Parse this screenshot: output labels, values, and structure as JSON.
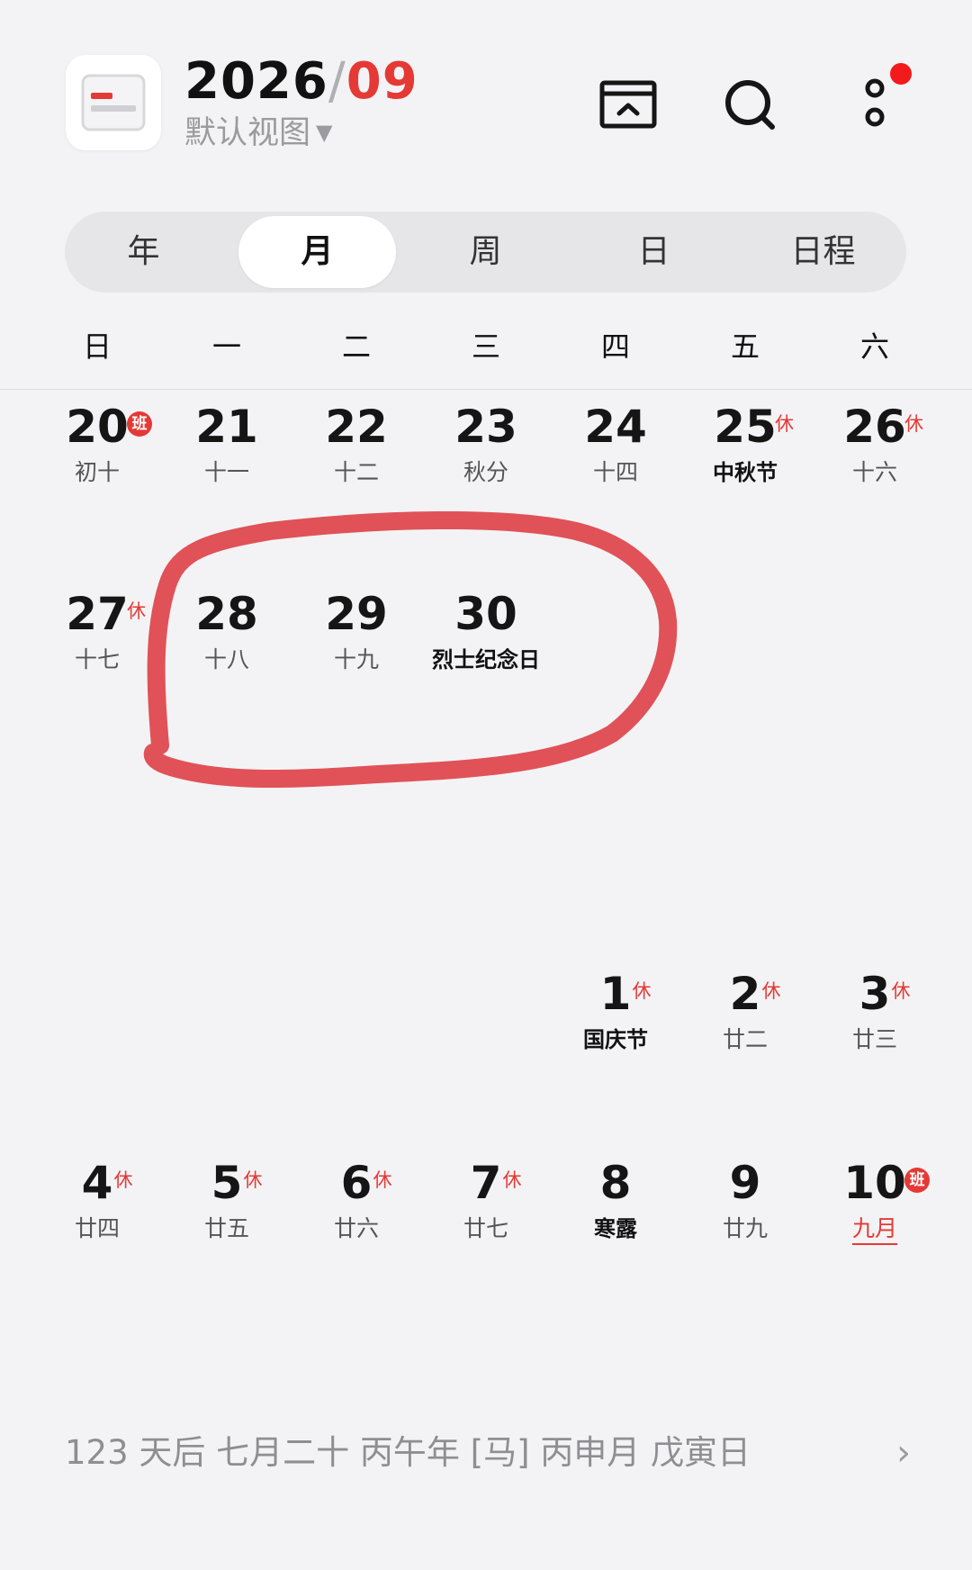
{
  "header": {
    "year": "2026",
    "slash": "/",
    "month": "09",
    "view_label": "默认视图",
    "view_caret": "▼",
    "icons": [
      "calendar-app-icon",
      "inbox-icon",
      "search-icon",
      "more-icon"
    ],
    "accent_color": "#e53935"
  },
  "tabs": [
    {
      "label": "年",
      "active": false
    },
    {
      "label": "月",
      "active": true
    },
    {
      "label": "周",
      "active": false
    },
    {
      "label": "日",
      "active": false
    },
    {
      "label": "日程",
      "active": false
    }
  ],
  "weekdays": [
    "日",
    "一",
    "二",
    "三",
    "四",
    "五",
    "六"
  ],
  "weeks": [
    [
      {
        "day": "20",
        "sub": "初十",
        "badge": "班"
      },
      {
        "day": "21",
        "sub": "十一"
      },
      {
        "day": "22",
        "sub": "十二"
      },
      {
        "day": "23",
        "sub": "秋分"
      },
      {
        "day": "24",
        "sub": "十四"
      },
      {
        "day": "25",
        "sub": "中秋节",
        "badge": "休",
        "holiday": true
      },
      {
        "day": "26",
        "sub": "十六",
        "badge": "休"
      }
    ],
    [
      {
        "day": "27",
        "sub": "十七",
        "badge": "休"
      },
      {
        "day": "28",
        "sub": "十八"
      },
      {
        "day": "29",
        "sub": "十九"
      },
      {
        "day": "30",
        "sub": "烈士纪念日",
        "holiday": true
      }
    ],
    [],
    [
      null,
      null,
      null,
      null,
      {
        "day": "1",
        "sub": "国庆节",
        "badge": "休",
        "holiday": true
      },
      {
        "day": "2",
        "sub": "廿二",
        "badge": "休"
      },
      {
        "day": "3",
        "sub": "廿三",
        "badge": "休"
      }
    ],
    [
      {
        "day": "4",
        "sub": "廿四",
        "badge": "休"
      },
      {
        "day": "5",
        "sub": "廿五",
        "badge": "休"
      },
      {
        "day": "6",
        "sub": "廿六",
        "badge": "休"
      },
      {
        "day": "7",
        "sub": "廿七",
        "badge": "休"
      },
      {
        "day": "8",
        "sub": "寒露",
        "holiday": true
      },
      {
        "day": "9",
        "sub": "廿九"
      },
      {
        "day": "10",
        "sub": "九月",
        "badge": "班",
        "underline": true
      }
    ]
  ],
  "footer": {
    "text": "123 天后 七月二十 丙午年 [马] 丙申月 戊寅日",
    "chevron": "›"
  }
}
